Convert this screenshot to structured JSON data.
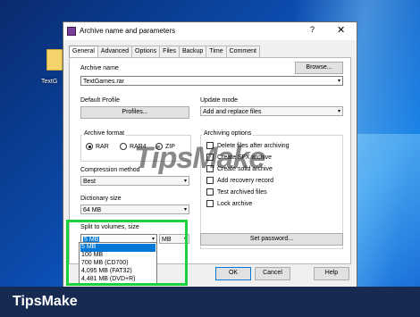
{
  "desktop": {
    "icon_label": "TextG"
  },
  "dialog": {
    "title": "Archive name and parameters",
    "help_glyph": "?",
    "close_glyph": "✕",
    "tabs": [
      "General",
      "Advanced",
      "Options",
      "Files",
      "Backup",
      "Time",
      "Comment"
    ],
    "archive_name_label": "Archive name",
    "browse_label": "Browse...",
    "archive_name_value": "TextGames.rar",
    "default_profile_label": "Default Profile",
    "profiles_label": "Profiles...",
    "update_mode_label": "Update mode",
    "update_mode_value": "Add and replace files",
    "archive_format_label": "Archive format",
    "formats": [
      "RAR",
      "RAR4",
      "ZIP"
    ],
    "selected_format": "RAR",
    "compression_method_label": "Compression method",
    "compression_method_value": "Best",
    "dictionary_size_label": "Dictionary size",
    "dictionary_size_value": "64 MB",
    "split_label": "Split to volumes, size",
    "split_value": "5 MB",
    "split_unit": "MB",
    "split_options": [
      "5 MB",
      "100 MB",
      "700 MB  (CD700)",
      "4,095 MB  (FAT32)",
      "4,481 MB  (DVD+R)"
    ],
    "archiving_options_label": "Archiving options",
    "archiving_options": [
      "Delete files after archiving",
      "Create SFX archive",
      "Create solid archive",
      "Add recovery record",
      "Test archived files",
      "Lock archive"
    ],
    "set_password_label": "Set password...",
    "ok_label": "OK",
    "cancel_label": "Cancel",
    "help_label": "Help"
  },
  "watermark": "TipsMake",
  "banner": {
    "text": "TipsMake",
    "color": "#172a52"
  },
  "highlight_color": "#19d23c"
}
